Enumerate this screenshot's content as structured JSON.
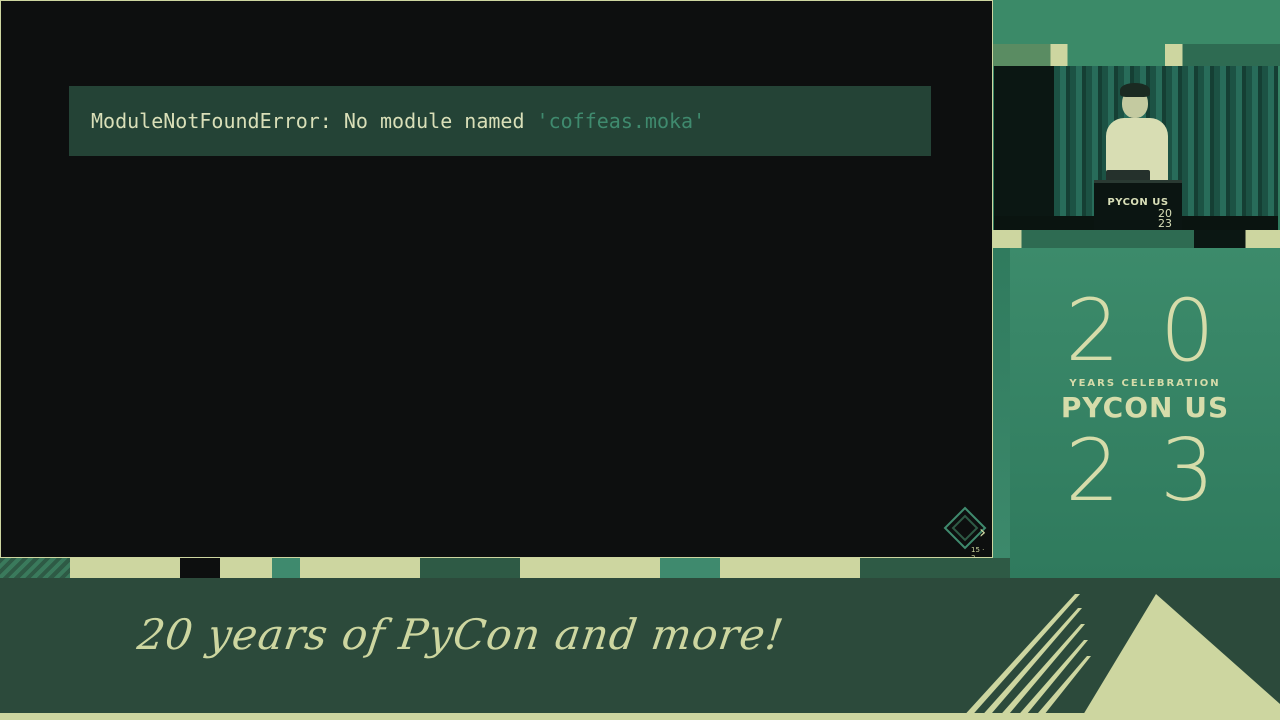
{
  "slide": {
    "error": {
      "type": "ModuleNotFoundError:",
      "message": " No module ",
      "keyword": "named",
      "module_string": " 'coffeas.moka'"
    },
    "nav": {
      "chevron": "›",
      "counter": "15 · 3"
    }
  },
  "speaker_video": {
    "podium_text": "PYCON US",
    "podium_year_top": "20",
    "podium_year_bottom": "23"
  },
  "brand": {
    "year_top": "20",
    "tag": "YEARS CELEBRATION",
    "name": "PYCON US",
    "year_bottom": "23"
  },
  "banner": {
    "tagline": "20 years of PyCon and more!"
  },
  "colors": {
    "accent_cream": "#cdd6a0",
    "accent_green": "#3f8a6e",
    "slide_bg": "#0d0f0f",
    "banner_bg": "#2c4a3b"
  }
}
